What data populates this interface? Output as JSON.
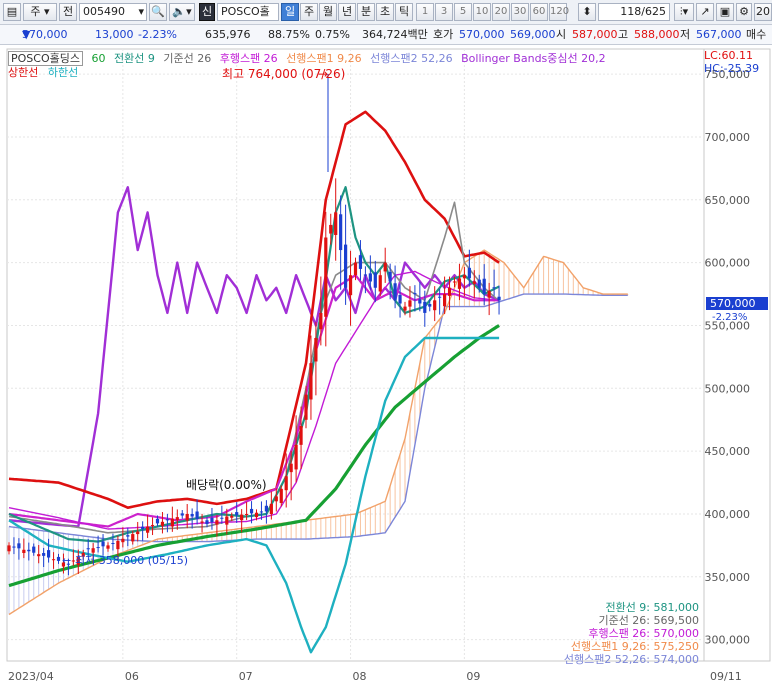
{
  "toolbar": {
    "mode_a": "주",
    "mode_b": "전",
    "code": "005490",
    "sin": "신",
    "name": "POSCO홀딩스",
    "periods": [
      "일",
      "주",
      "월",
      "년",
      "분",
      "초",
      "틱"
    ],
    "selected_period": "일",
    "intervals": [
      "1",
      "3",
      "5",
      "10",
      "20",
      "30",
      "60",
      "120"
    ],
    "count": "118/625",
    "right_cut": "20"
  },
  "quote": {
    "price": "570,000",
    "change": "13,000",
    "rate": "-2.23%",
    "volume": "635,976",
    "vol_ratio": "88.75%",
    "vol_pct": "0.75%",
    "amount": "364,724백만",
    "ask_label": "호가",
    "ask": "570,000",
    "bid": "569,000",
    "open_label": "시",
    "open": "587,000",
    "high_label": "고",
    "high": "588,000",
    "low_label": "저",
    "low": "567,000",
    "cut": "매수"
  },
  "legend": {
    "name": "POSCO홀딩스",
    "period": "60",
    "tenkan": "전환선 9",
    "kijun": "기준선 26",
    "chikou": "후행스팬 26",
    "senkou1": "선행스팬1 9,26",
    "senkou2": "선행스팬2 52,26",
    "bb": "Bollinger Bands중심선 20,2",
    "upper": "상한선",
    "lower": "하한선",
    "lc": "LC:60.11",
    "hc": "HC:-25.39"
  },
  "colors": {
    "up": "#e01010",
    "down": "#1a3fd0",
    "tenkan": "#1e9482",
    "kijun": "#8a8a8a",
    "chikou": "#c21bd6",
    "senkou1": "#f2a26a",
    "senkou2": "#7c86d8",
    "bb_mid": "#cc22cc",
    "bb_upper": "#dd1010",
    "bb_lower": "#1eb0c0",
    "ma_long": "#17a033",
    "rsi": "#a12fd6"
  },
  "chart_data": {
    "type": "candlestick",
    "y_ticks": [
      "750,000",
      "700,000",
      "650,000",
      "600,000",
      "550,000",
      "500,000",
      "450,000",
      "400,000",
      "350,000",
      "300,000"
    ],
    "ylim": [
      283000,
      770000
    ],
    "x_ticks": [
      "2023/04",
      "06",
      "07",
      "08",
      "09",
      "09/11"
    ],
    "annotations": {
      "high": "최고 764,000 (07/26)",
      "low": "최저 358,000 (05/15)",
      "dividend": "배당락(0.00%)"
    },
    "current": {
      "price": "570,000",
      "rate": "-2.23%"
    },
    "bottom_values": [
      "전환선 9: 581,000",
      "기준선 26: 569,500",
      "후행스팬 26: 570,000",
      "선행스팬1 9,26: 575,250",
      "선행스팬2 52,26: 574,000"
    ],
    "candle_anchors": [
      [
        0,
        375000
      ],
      [
        6,
        368000
      ],
      [
        12,
        360000
      ],
      [
        16,
        372000
      ],
      [
        20,
        375000
      ],
      [
        24,
        382000
      ],
      [
        28,
        390000
      ],
      [
        32,
        395000
      ],
      [
        36,
        400000
      ],
      [
        40,
        392000
      ],
      [
        44,
        398000
      ],
      [
        48,
        400000
      ],
      [
        52,
        402000
      ],
      [
        55,
        420000
      ],
      [
        57,
        440000
      ],
      [
        59,
        470000
      ],
      [
        61,
        520000
      ],
      [
        63,
        560000
      ],
      [
        64,
        620000
      ],
      [
        66,
        640000
      ],
      [
        68,
        580000
      ],
      [
        70,
        600000
      ],
      [
        72,
        590000
      ],
      [
        74,
        580000
      ],
      [
        76,
        600000
      ],
      [
        78,
        570000
      ],
      [
        80,
        565000
      ],
      [
        82,
        575000
      ],
      [
        84,
        560000
      ],
      [
        86,
        570000
      ],
      [
        88,
        575000
      ],
      [
        90,
        585000
      ],
      [
        92,
        590000
      ],
      [
        94,
        585000
      ],
      [
        96,
        575000
      ],
      [
        98,
        580000
      ],
      [
        99,
        570000
      ]
    ],
    "lines": {
      "bb_upper": [
        [
          0,
          428000
        ],
        [
          10,
          425000
        ],
        [
          20,
          412000
        ],
        [
          24,
          405000
        ],
        [
          30,
          410000
        ],
        [
          36,
          412000
        ],
        [
          42,
          408000
        ],
        [
          48,
          412000
        ],
        [
          54,
          420000
        ],
        [
          60,
          520000
        ],
        [
          64,
          650000
        ],
        [
          68,
          710000
        ],
        [
          72,
          720000
        ],
        [
          76,
          705000
        ],
        [
          80,
          680000
        ],
        [
          84,
          650000
        ],
        [
          88,
          635000
        ],
        [
          92,
          605000
        ],
        [
          96,
          608000
        ],
        [
          99,
          600000
        ]
      ],
      "bb_lower": [
        [
          0,
          395000
        ],
        [
          8,
          375000
        ],
        [
          16,
          368000
        ],
        [
          24,
          362000
        ],
        [
          32,
          368000
        ],
        [
          40,
          375000
        ],
        [
          48,
          380000
        ],
        [
          52,
          375000
        ],
        [
          56,
          345000
        ],
        [
          59,
          310000
        ],
        [
          61,
          290000
        ],
        [
          64,
          310000
        ],
        [
          68,
          360000
        ],
        [
          72,
          430000
        ],
        [
          76,
          490000
        ],
        [
          80,
          525000
        ],
        [
          84,
          540000
        ],
        [
          90,
          540000
        ],
        [
          95,
          540000
        ],
        [
          99,
          540000
        ]
      ],
      "bb_mid": [
        [
          0,
          405000
        ],
        [
          10,
          397000
        ],
        [
          20,
          388000
        ],
        [
          30,
          390000
        ],
        [
          40,
          393000
        ],
        [
          48,
          394000
        ],
        [
          54,
          400000
        ],
        [
          58,
          425000
        ],
        [
          62,
          470000
        ],
        [
          66,
          520000
        ],
        [
          70,
          545000
        ],
        [
          74,
          570000
        ],
        [
          78,
          590000
        ],
        [
          82,
          593000
        ],
        [
          86,
          585000
        ],
        [
          90,
          578000
        ],
        [
          94,
          572000
        ],
        [
          99,
          570000
        ]
      ],
      "tenkan": [
        [
          0,
          400000
        ],
        [
          6,
          390000
        ],
        [
          12,
          380000
        ],
        [
          18,
          378000
        ],
        [
          24,
          385000
        ],
        [
          30,
          390000
        ],
        [
          36,
          395000
        ],
        [
          42,
          400000
        ],
        [
          48,
          398000
        ],
        [
          52,
          400000
        ],
        [
          56,
          430000
        ],
        [
          60,
          480000
        ],
        [
          63,
          560000
        ],
        [
          66,
          640000
        ],
        [
          68,
          660000
        ],
        [
          70,
          620000
        ],
        [
          72,
          600000
        ],
        [
          74,
          590000
        ],
        [
          76,
          600000
        ],
        [
          78,
          570000
        ],
        [
          80,
          560000
        ],
        [
          84,
          565000
        ],
        [
          88,
          585000
        ],
        [
          92,
          590000
        ],
        [
          96,
          575000
        ],
        [
          99,
          581000
        ]
      ],
      "kijun": [
        [
          0,
          398000
        ],
        [
          10,
          392000
        ],
        [
          20,
          385000
        ],
        [
          30,
          388000
        ],
        [
          40,
          390000
        ],
        [
          48,
          398000
        ],
        [
          52,
          400000
        ],
        [
          56,
          430000
        ],
        [
          60,
          500000
        ],
        [
          63,
          560000
        ],
        [
          66,
          590000
        ],
        [
          70,
          600000
        ],
        [
          76,
          600000
        ],
        [
          80,
          580000
        ],
        [
          84,
          570000
        ],
        [
          88,
          620000
        ],
        [
          90,
          648000
        ],
        [
          92,
          600000
        ],
        [
          96,
          580000
        ],
        [
          99,
          569500
        ]
      ],
      "chikou": [
        [
          0,
          400000
        ],
        [
          10,
          395000
        ],
        [
          20,
          390000
        ],
        [
          26,
          400000
        ],
        [
          34,
          395000
        ],
        [
          42,
          398000
        ],
        [
          48,
          410000
        ],
        [
          54,
          420000
        ],
        [
          58,
          460000
        ],
        [
          62,
          530000
        ],
        [
          66,
          580000
        ],
        [
          70,
          590000
        ],
        [
          74,
          570000
        ],
        [
          78,
          578000
        ],
        [
          82,
          570000
        ],
        [
          86,
          575000
        ],
        [
          90,
          575000
        ],
        [
          94,
          570000
        ],
        [
          99,
          570000
        ]
      ],
      "senkou1": [
        [
          0,
          320000
        ],
        [
          10,
          345000
        ],
        [
          20,
          365000
        ],
        [
          30,
          380000
        ],
        [
          40,
          385000
        ],
        [
          50,
          390000
        ],
        [
          60,
          395000
        ],
        [
          70,
          400000
        ],
        [
          76,
          410000
        ],
        [
          80,
          460000
        ],
        [
          84,
          540000
        ],
        [
          88,
          560000
        ],
        [
          92,
          600000
        ],
        [
          96,
          610000
        ],
        [
          100,
          600000
        ],
        [
          104,
          580000
        ],
        [
          108,
          605000
        ],
        [
          112,
          600000
        ],
        [
          116,
          580000
        ],
        [
          120,
          575000
        ],
        [
          125,
          575000
        ]
      ],
      "senkou2": [
        [
          0,
          390000
        ],
        [
          10,
          385000
        ],
        [
          20,
          380000
        ],
        [
          30,
          378000
        ],
        [
          40,
          378000
        ],
        [
          50,
          380000
        ],
        [
          60,
          380000
        ],
        [
          70,
          382000
        ],
        [
          76,
          385000
        ],
        [
          80,
          410000
        ],
        [
          84,
          500000
        ],
        [
          88,
          565000
        ],
        [
          92,
          565000
        ],
        [
          96,
          565000
        ],
        [
          100,
          570000
        ],
        [
          104,
          575000
        ],
        [
          112,
          575000
        ],
        [
          120,
          574000
        ],
        [
          125,
          574000
        ]
      ],
      "ma_long": [
        [
          0,
          343000
        ],
        [
          10,
          355000
        ],
        [
          20,
          365000
        ],
        [
          30,
          375000
        ],
        [
          40,
          382000
        ],
        [
          50,
          388000
        ],
        [
          60,
          395000
        ],
        [
          66,
          420000
        ],
        [
          72,
          455000
        ],
        [
          78,
          485000
        ],
        [
          84,
          505000
        ],
        [
          90,
          525000
        ],
        [
          95,
          540000
        ],
        [
          99,
          550000
        ]
      ],
      "rsi": [
        [
          0,
          395000
        ],
        [
          8,
          392000
        ],
        [
          14,
          390000
        ],
        [
          18,
          480000
        ],
        [
          22,
          640000
        ],
        [
          24,
          660000
        ],
        [
          26,
          610000
        ],
        [
          28,
          640000
        ],
        [
          30,
          590000
        ],
        [
          32,
          560000
        ],
        [
          34,
          600000
        ],
        [
          36,
          560000
        ],
        [
          38,
          600000
        ],
        [
          40,
          580000
        ],
        [
          42,
          560000
        ],
        [
          44,
          590000
        ],
        [
          46,
          580000
        ],
        [
          48,
          560000
        ],
        [
          50,
          590000
        ],
        [
          52,
          570000
        ],
        [
          54,
          580000
        ],
        [
          56,
          560000
        ],
        [
          58,
          590000
        ],
        [
          60,
          570000
        ],
        [
          62,
          550000
        ],
        [
          64,
          590000
        ],
        [
          66,
          570000
        ],
        [
          68,
          580000
        ],
        [
          70,
          560000
        ],
        [
          72,
          590000
        ],
        [
          74,
          570000
        ],
        [
          76,
          580000
        ],
        [
          78,
          570000
        ],
        [
          80,
          600000
        ],
        [
          82,
          590000
        ],
        [
          84,
          580000
        ],
        [
          86,
          590000
        ],
        [
          88,
          580000
        ],
        [
          90,
          590000
        ],
        [
          92,
          580000
        ],
        [
          94,
          585000
        ],
        [
          96,
          575000
        ],
        [
          99,
          570000
        ]
      ]
    }
  }
}
